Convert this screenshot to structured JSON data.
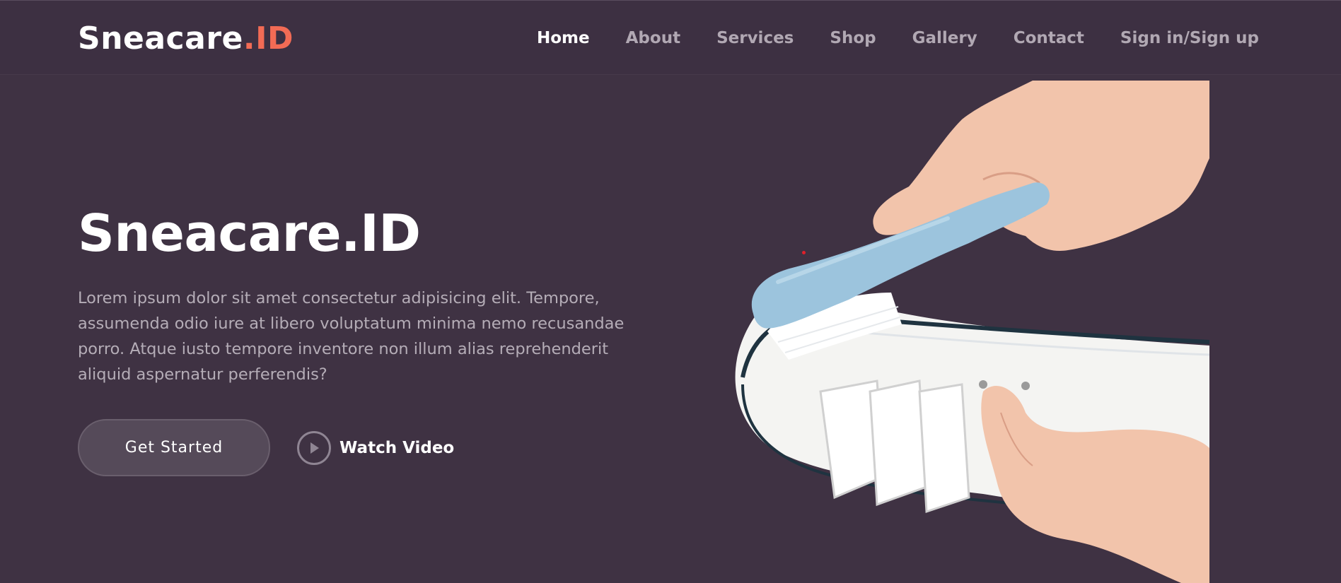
{
  "brand": {
    "name": "Sneacare",
    "suffix": ".ID"
  },
  "nav": {
    "items": [
      {
        "label": "Home",
        "active": true
      },
      {
        "label": "About"
      },
      {
        "label": "Services"
      },
      {
        "label": "Shop"
      },
      {
        "label": "Gallery"
      },
      {
        "label": "Contact"
      },
      {
        "label": "Sign in/Sign up"
      }
    ]
  },
  "hero": {
    "title": "Sneacare.ID",
    "description": "Lorem ipsum dolor sit amet consectetur adipisicing elit. Tempore, assumenda odio iure at libero voluptatum minima nemo recusandae porro. Atque iusto tempore inventore non illum alias reprehenderit aliquid aspernatur perferendis?",
    "cta_label": "Get Started",
    "video_label": "Watch Video",
    "image": "shoe-cleaning-brush-photo"
  },
  "colors": {
    "background": "#3f3243",
    "accent": "#f26b55",
    "nav_inactive": "#b1a8b3",
    "brush": "#9cc4dd"
  }
}
